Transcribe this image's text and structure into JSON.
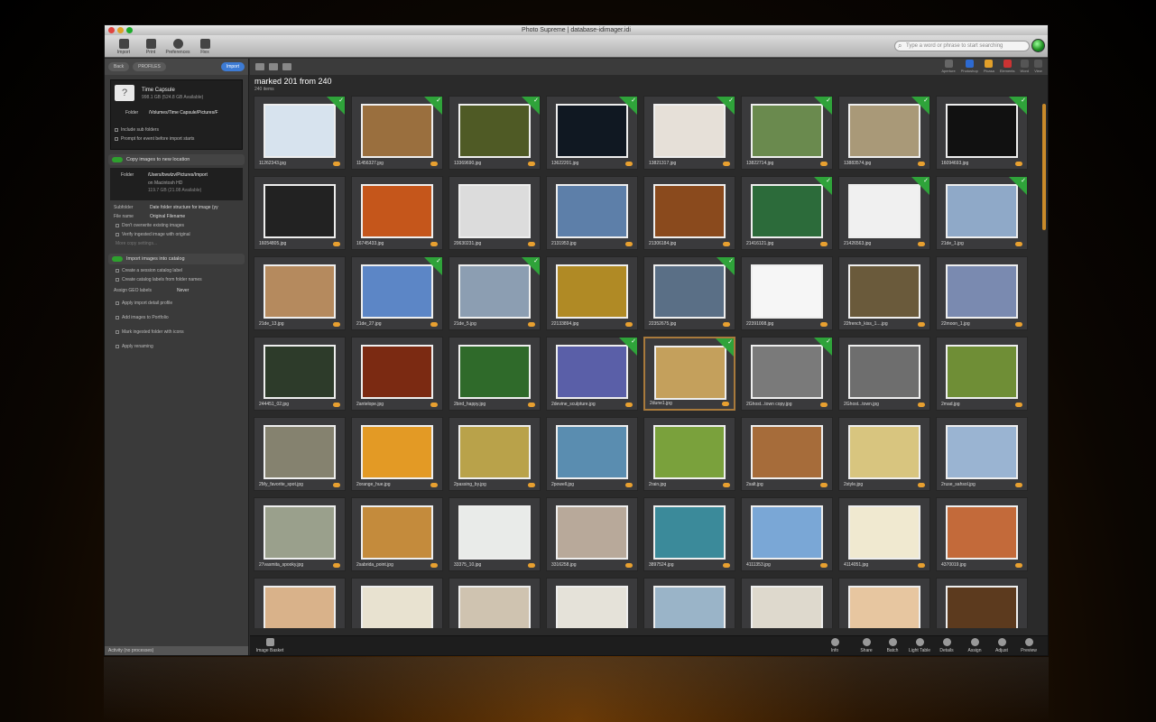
{
  "window": {
    "title": "Photo Supreme | database-idimager.idi"
  },
  "toolbar": {
    "buttons": [
      {
        "label": "Import",
        "icon": "download-icon"
      },
      {
        "label": "Print",
        "icon": "printer-icon"
      },
      {
        "label": "Preferences",
        "icon": "gear-icon"
      },
      {
        "label": "Flex",
        "icon": "flex-icon"
      }
    ],
    "search_placeholder": "Type a word or phrase to start searching"
  },
  "left_panel": {
    "back": "Back",
    "profiles": "PROFILES",
    "import": "Import",
    "source_name": "Time Capsule",
    "source_size": "998.1 GB (524.8 GB Available)",
    "folder_label": "Folder",
    "folder_value": "/Volumes/Time Capsule/Pictures/F",
    "src_opts": [
      "Include sub folders",
      "Prompt for event before import starts"
    ],
    "copy_section": "Copy images to new location",
    "dest_folder_label": "Folder",
    "dest_folder": "/Users/bvwlzv/Pictures/Import",
    "dest_disk": "on Macintosh HD",
    "dest_size": "119.7 GB (21.08 Available)",
    "rows": [
      {
        "k": "Subfolder",
        "v": "Date folder structure for image (yy"
      },
      {
        "k": "File name",
        "v": "Original Filename"
      }
    ],
    "copy_opts": [
      "Don't overwrite existing images",
      "Verify ingested image with original"
    ],
    "more": "More copy settings...",
    "catalog_section": "Import images into catalog",
    "catalog_opts": [
      "Create a session catalog label",
      "Create catalog labels from folder names"
    ],
    "assign_label": "Assign GEO labels",
    "assign_value": "Never",
    "extra_opts": [
      "Apply import detail profile",
      "Add images to Portfolio",
      "Mark ingested folder with icons",
      "Apply renaming"
    ],
    "activity": "Activity (no processes)"
  },
  "main": {
    "heading": "marked 201 from 240",
    "subheading": "240 items",
    "apps": [
      {
        "label": "Aperture",
        "color": "#666666"
      },
      {
        "label": "Photoshop",
        "color": "#2d6ad1"
      },
      {
        "label": "Picasa",
        "color": "#e3a02a"
      },
      {
        "label": "Elements",
        "color": "#c33"
      },
      {
        "label": "Word",
        "color": "#555"
      },
      {
        "label": "View",
        "color": "#555"
      }
    ],
    "thumbnails": [
      [
        "11262343.jpg",
        "11456327.jpg",
        "13369690.jpg",
        "13622201.jpg",
        "13821317.jpg",
        "13822714.jpg",
        "13883574.jpg",
        "16094693.jpg"
      ],
      [
        "16054805.jpg",
        "16745433.jpg",
        "20630231.jpg",
        "2131953.jpg",
        "21306184.jpg",
        "21416121.jpg",
        "21426563.jpg",
        "21de_1.jpg"
      ],
      [
        "21de_13.jpg",
        "21de_27.jpg",
        "21de_5.jpg",
        "22133894.jpg",
        "22352675.jpg",
        "22391008.jpg",
        "22french_kiss_1....jpg",
        "22moon_1.jpg"
      ],
      [
        "244451_02.jpg",
        "2antelope.jpg",
        "2bird_happy.jpg",
        "2devine_sculpture.jpg",
        "2dune1.jpg",
        "2Ghost...town copy.jpg",
        "2Ghost...town.jpg",
        "2mad.jpg"
      ],
      [
        "2My_favorite_spot.jpg",
        "2orange_hue.jpg",
        "2passing_by.jpg",
        "2powell.jpg",
        "2rain.jpg",
        "2salt.jpg",
        "2style.jpg",
        "2ruse_sahsol.jpg"
      ],
      [
        "27vasmita_spooky.jpg",
        "2sabrida_point.jpg",
        "33375_10.jpg",
        "3316258.jpg",
        "3897524.jpg",
        "4111353.jpg",
        "4114051.jpg",
        "4370019.jpg"
      ],
      [
        "",
        "",
        "",
        "",
        "",
        "",
        "",
        ""
      ]
    ],
    "marked_rows": [
      [
        true,
        true,
        true,
        true,
        true,
        true,
        true,
        true
      ],
      [
        false,
        false,
        false,
        false,
        false,
        true,
        true,
        true
      ],
      [
        false,
        true,
        true,
        false,
        true,
        false,
        false,
        false
      ],
      [
        false,
        false,
        false,
        true,
        true,
        true,
        false,
        false
      ],
      [
        false,
        false,
        false,
        false,
        false,
        false,
        false,
        false
      ],
      [
        false,
        false,
        false,
        false,
        false,
        false,
        false,
        false
      ],
      [
        false,
        false,
        false,
        false,
        false,
        false,
        false,
        false
      ]
    ],
    "thumb_colors": [
      [
        "#d7e3ee",
        "#9a6f3e",
        "#4f5a25",
        "#101822",
        "#e6e0d8",
        "#6a8a4e",
        "#a99978",
        "#111111"
      ],
      [
        "#222222",
        "#c5561b",
        "#dcdcdc",
        "#5d7fa9",
        "#8a4a1d",
        "#2c6b3a",
        "#f0f0f0",
        "#8fa9c8"
      ],
      [
        "#b58a5e",
        "#5c86c6",
        "#8c9eb2",
        "#b08a25",
        "#5a6f86",
        "#f6f6f6",
        "#6a5a3b",
        "#7a8ab0"
      ],
      [
        "#2d3b2a",
        "#7b2a12",
        "#2f6a2a",
        "#5a5fa8",
        "#c4a05c",
        "#7a7a7a",
        "#6e6e6e",
        "#6f8e36"
      ],
      [
        "#85826f",
        "#e39a25",
        "#b9a24a",
        "#5a8db0",
        "#7aa13c",
        "#a66c3a",
        "#d8c57f",
        "#9ab4d2"
      ],
      [
        "#9aa08c",
        "#c48b3c",
        "#e9ebe9",
        "#b8a99a",
        "#3b8a9a",
        "#7aa7d6",
        "#f0e9d0",
        "#c36a3a"
      ],
      [
        "#d9b28a",
        "#e8e2d0",
        "#cfc3b0",
        "#e5e2d9",
        "#9ab4c8",
        "#ded9cd",
        "#e7c6a0",
        "#5c3a1e"
      ]
    ],
    "selected_index": [
      3,
      4
    ]
  },
  "bottom_bar": {
    "left": "Image Basket",
    "items": [
      "Info",
      "Share",
      "Batch",
      "Light Table",
      "Details",
      "Assign",
      "Adjust",
      "Preview"
    ]
  }
}
